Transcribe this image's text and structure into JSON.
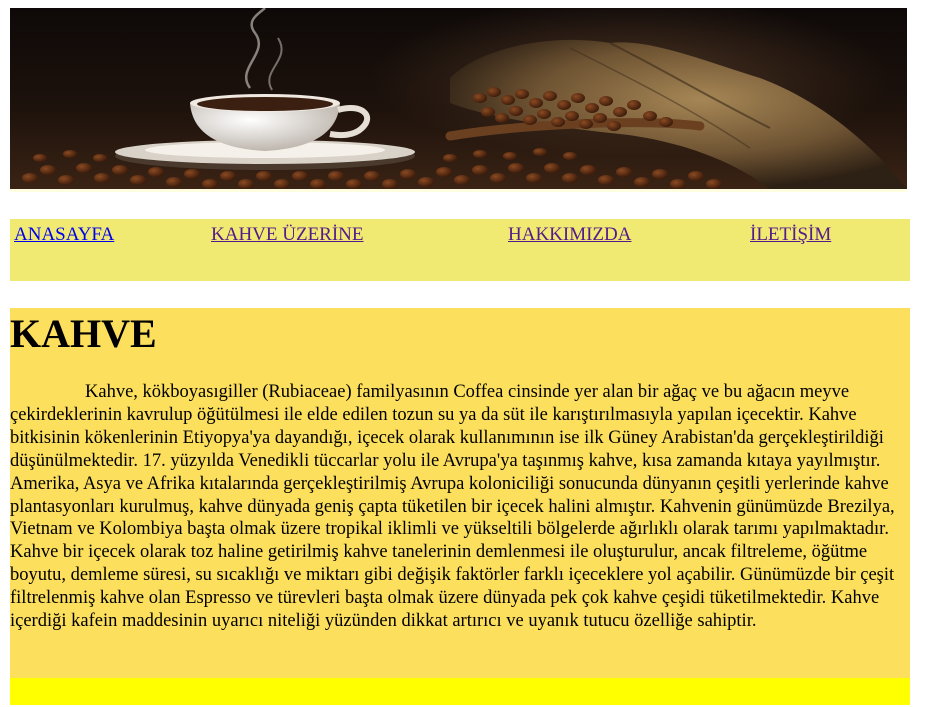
{
  "nav": {
    "items": [
      {
        "label": "ANASAYFA"
      },
      {
        "label": "KAHVE ÜZERİNE"
      },
      {
        "label": "HAKKIMIZDA"
      },
      {
        "label": "İLETİŞİM"
      }
    ]
  },
  "main": {
    "title": "KAHVE",
    "paragraph": "Kahve, kökboyasıgiller (Rubiaceae) familyasının Coffea cinsinde yer alan bir ağaç ve bu ağacın meyve çekirdeklerinin kavrulup öğütülmesi ile elde edilen tozun su ya da süt ile karıştırılmasıyla yapılan içecektir. Kahve bitkisinin kökenlerinin Etiyopya'ya dayandığı, içecek olarak kullanımının ise ilk Güney Arabistan'da gerçekleştirildiği düşünülmektedir. 17. yüzyılda Venedikli tüccarlar yolu ile Avrupa'ya taşınmış kahve, kısa zamanda kıtaya yayılmıştır. Amerika, Asya ve Afrika kıtalarında gerçekleştirilmiş Avrupa koloniciliği sonucunda dünyanın çeşitli yerlerinde kahve plantasyonları kurulmuş, kahve dünyada geniş çapta tüketilen bir içecek halini almıştır. Kahvenin günümüzde Brezilya, Vietnam ve Kolombiya başta olmak üzere tropikal iklimli ve yükseltili bölgelerde ağırlıklı olarak tarımı yapılmaktadır. Kahve bir içecek olarak toz haline getirilmiş kahve tanelerinin demlenmesi ile oluşturulur, ancak filtreleme, öğütme boyutu, demleme süresi, su sıcaklığı ve miktarı gibi değişik faktörler farklı içeceklere yol açabilir. Günümüzde bir çeşit filtrelenmiş kahve olan Espresso ve türevleri başta olmak üzere dünyada pek çok kahve çeşidi tüketilmektedir. Kahve içerdiği kafein maddesinin uyarıcı niteliği yüzünden dikkat artırıcı ve uyanık tutucu özelliğe sahiptir."
  },
  "colors": {
    "nav_bg": "#f0ea72",
    "content_bg": "#fcdf5c",
    "footer_bg": "#ffff00",
    "link": "#0000ee",
    "link_visited": "#551a8b"
  }
}
